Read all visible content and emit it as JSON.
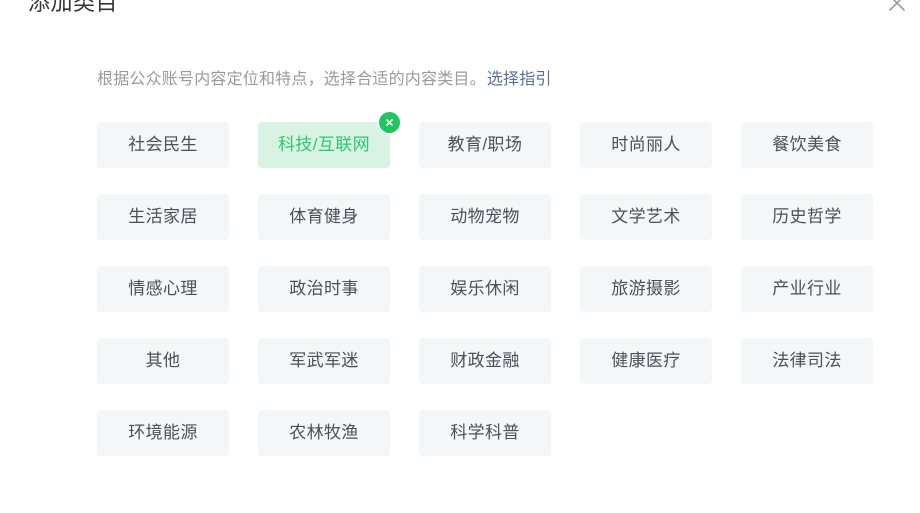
{
  "dialog": {
    "title": "添加类目",
    "close_icon": "close-icon"
  },
  "description": {
    "text": "根据公众账号内容定位和特点，选择合适的内容类目。",
    "link_label": "选择指引"
  },
  "colors": {
    "chip_background": "#f5f6f7",
    "chip_text": "#4b5058",
    "selected_chip_background": "#d8f2e3",
    "selected_chip_text": "#2ac96f",
    "remove_badge_background": "#20c55e",
    "link": "#5b6e9e",
    "title_text": "#353535",
    "description_text": "#9a9a9a",
    "page_background": "#ffffff"
  },
  "category_grid": {
    "columns": 5,
    "selected": "科技/互联网",
    "remove_icon": "close-circle-icon",
    "items": [
      {
        "label": "社会民生",
        "selected": false
      },
      {
        "label": "科技/互联网",
        "selected": true
      },
      {
        "label": "教育/职场",
        "selected": false
      },
      {
        "label": "时尚丽人",
        "selected": false
      },
      {
        "label": "餐饮美食",
        "selected": false
      },
      {
        "label": "生活家居",
        "selected": false
      },
      {
        "label": "体育健身",
        "selected": false
      },
      {
        "label": "动物宠物",
        "selected": false
      },
      {
        "label": "文学艺术",
        "selected": false
      },
      {
        "label": "历史哲学",
        "selected": false
      },
      {
        "label": "情感心理",
        "selected": false
      },
      {
        "label": "政治时事",
        "selected": false
      },
      {
        "label": "娱乐休闲",
        "selected": false
      },
      {
        "label": "旅游摄影",
        "selected": false
      },
      {
        "label": "产业行业",
        "selected": false
      },
      {
        "label": "其他",
        "selected": false
      },
      {
        "label": "军武军迷",
        "selected": false
      },
      {
        "label": "财政金融",
        "selected": false
      },
      {
        "label": "健康医疗",
        "selected": false
      },
      {
        "label": "法律司法",
        "selected": false
      },
      {
        "label": "环境能源",
        "selected": false
      },
      {
        "label": "农林牧渔",
        "selected": false
      },
      {
        "label": "科学科普",
        "selected": false
      }
    ]
  }
}
